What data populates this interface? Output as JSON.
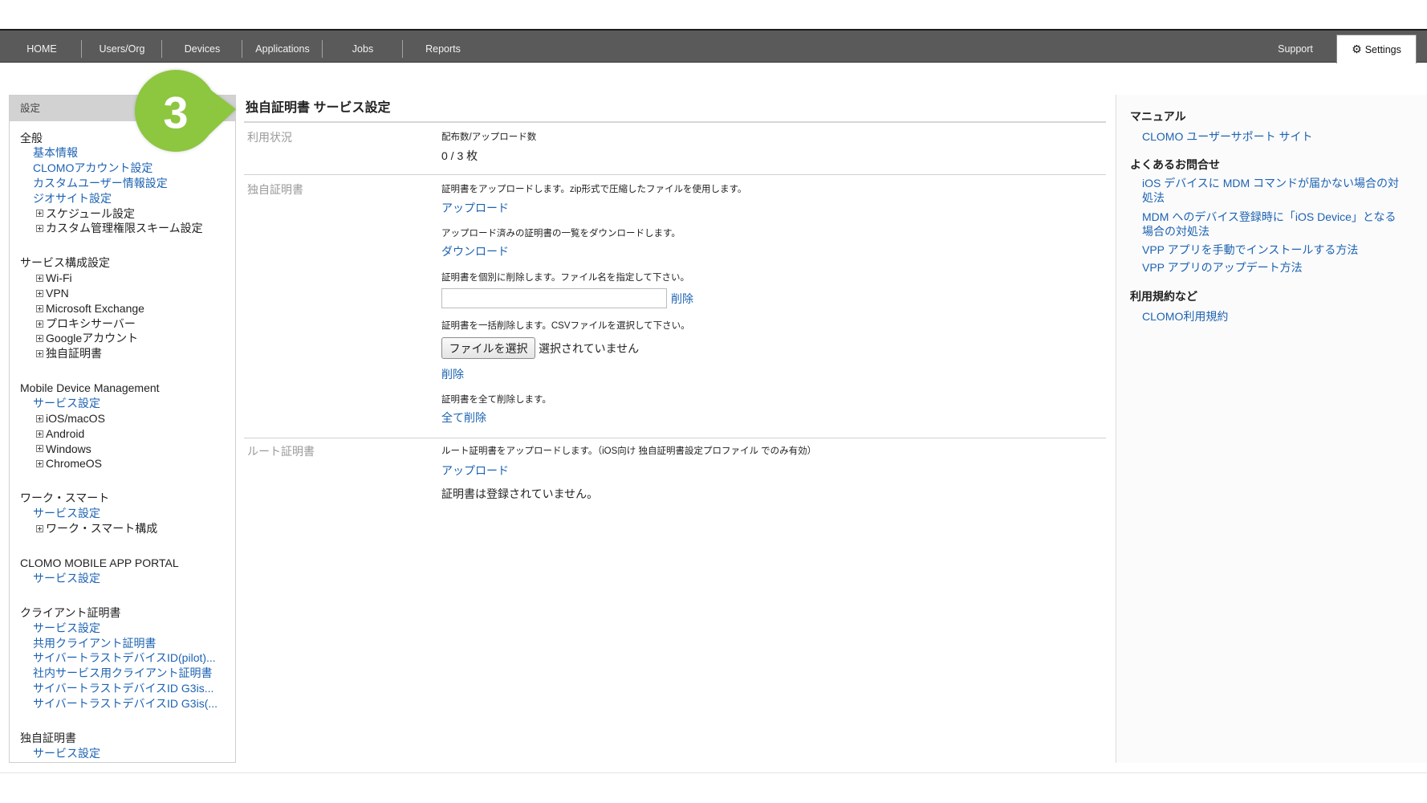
{
  "nav": {
    "items": [
      "HOME",
      "Users/Org",
      "Devices",
      "Applications",
      "Jobs",
      "Reports"
    ],
    "support": "Support",
    "settings": "Settings",
    "settings_icon": "gear-icon"
  },
  "step_badge": {
    "number": "3",
    "color": "#8dc63f"
  },
  "sidebar": {
    "header": "設定",
    "sections": [
      {
        "title": "全般",
        "links": [
          "基本情報",
          "CLOMOアカウント設定",
          "カスタムユーザー情報設定",
          "ジオサイト設定"
        ],
        "tree": [
          "スケジュール設定",
          "カスタム管理権限スキーム設定"
        ]
      },
      {
        "title": "サービス構成設定",
        "tree": [
          "Wi-Fi",
          "VPN",
          "Microsoft Exchange",
          "プロキシサーバー",
          "Googleアカウント",
          "独自証明書"
        ]
      },
      {
        "title": "Mobile Device Management",
        "links": [
          "サービス設定"
        ],
        "tree": [
          "iOS/macOS",
          "Android",
          "Windows",
          "ChromeOS"
        ]
      },
      {
        "title": "ワーク・スマート",
        "links": [
          "サービス設定"
        ],
        "tree": [
          "ワーク・スマート構成"
        ]
      },
      {
        "title": "CLOMO MOBILE APP PORTAL",
        "links": [
          "サービス設定"
        ]
      },
      {
        "title": "クライアント証明書",
        "links": [
          "サービス設定",
          "共用クライアント証明書",
          "サイバートラストデバイスID(pilot)...",
          "社内サービス用クライアント証明書",
          "サイバートラストデバイスID G3is...",
          "サイバートラストデバイスID G3is(..."
        ]
      },
      {
        "title": "独自証明書",
        "links": [
          "サービス設定"
        ]
      }
    ]
  },
  "main": {
    "title": "独自証明書 サービス設定",
    "usage": {
      "label": "利用状況",
      "caption": "配布数/アップロード数",
      "count": "0 / 3 枚"
    },
    "certs": {
      "label": "独自証明書",
      "upload_desc": "証明書をアップロードします。zip形式で圧縮したファイルを使用します。",
      "upload_link": "アップロード",
      "download_desc": "アップロード済みの証明書の一覧をダウンロードします。",
      "download_link": "ダウンロード",
      "delete_one_desc": "証明書を個別に削除します。ファイル名を指定して下さい。",
      "delete_one_link": "削除",
      "bulk_delete_desc": "証明書を一括削除します。CSVファイルを選択して下さい。",
      "choose_file_button": "ファイルを選択",
      "no_file_text": "選択されていません",
      "bulk_delete_link": "削除",
      "delete_all_desc": "証明書を全て削除します。",
      "delete_all_link": "全て削除"
    },
    "root": {
      "label": "ルート証明書",
      "upload_desc": "ルート証明書をアップロードします。（iOS向け 独自証明書設定プロファイル でのみ有効）",
      "upload_link": "アップロード",
      "status": "証明書は登録されていません。"
    }
  },
  "help": {
    "manual_heading": "マニュアル",
    "manual_links": [
      "CLOMO ユーザーサポート サイト"
    ],
    "faq_heading": "よくあるお問合せ",
    "faq_links": [
      "iOS デバイスに MDM コマンドが届かない場合の対処法",
      "MDM へのデバイス登録時に「iOS Device」となる場合の対処法",
      "VPP アプリを手動でインストールする方法",
      "VPP アプリのアップデート方法"
    ],
    "terms_heading": "利用規約など",
    "terms_links": [
      "CLOMO利用規約"
    ]
  },
  "theme": {
    "link": "#1d63b2",
    "nav_bg": "#5a5a5a",
    "badge": "#8dc63f"
  }
}
